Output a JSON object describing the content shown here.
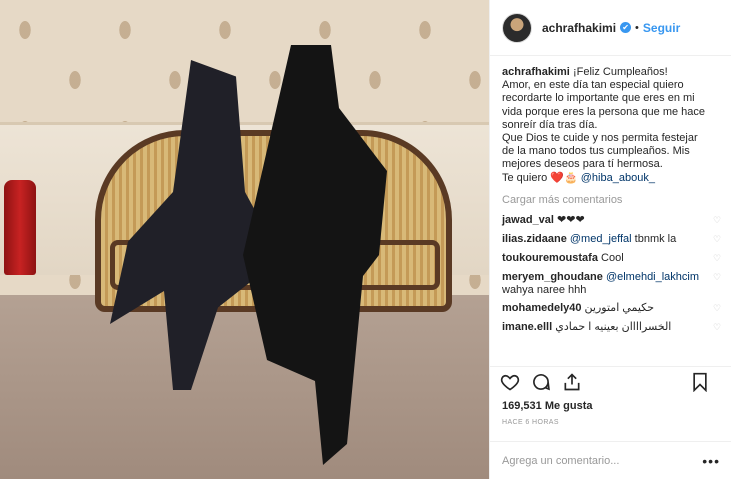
{
  "post": {
    "username": "achrafhakimi",
    "verified_mark": "✔",
    "separator": "•",
    "follow_label": "Seguir"
  },
  "caption": {
    "username": "achrafhakimi",
    "lines": [
      "¡Feliz Cumpleaños!",
      "Amor, en este día tan especial quiero",
      "recordarte lo importante que eres en mi",
      "vida porque eres la persona que me hace",
      "sonreír día tras día.",
      "Que Dios te cuide y nos permita festejar",
      "de la mano todos tus cumpleaños. Mis",
      "mejores deseos para tí hermosa."
    ],
    "last_line_text": "Te quiero ❤️🎂",
    "mention": "@hiba_abouk_"
  },
  "load_more_label": "Cargar más comentarios",
  "comments": [
    {
      "user": "jawad_val",
      "text": "❤❤❤",
      "mention": ""
    },
    {
      "user": "ilias.zidaane",
      "text": " tbnmk la",
      "mention": "@med_jeffal"
    },
    {
      "user": "toukouremoustafa",
      "text": "Cool",
      "mention": ""
    },
    {
      "user": "meryem_ghoudane",
      "text": " wahya naree hhh",
      "mention": "@elmehdi_lakhcim"
    },
    {
      "user": "mohamedely40",
      "text": "حكيمي امتورين",
      "mention": ""
    },
    {
      "user": "imane.elll",
      "text": "الخسراااان بعينيه ا حمادي",
      "mention": ""
    }
  ],
  "icons": {
    "like": "heart-icon",
    "comment": "comment-icon",
    "share": "share-icon",
    "save": "bookmark-icon",
    "small_like": "♡"
  },
  "likes_label": "169,531 Me gusta",
  "timestamp": "HACE 6 HORAS",
  "add_comment_placeholder": "Agrega un comentario...",
  "more_options": "•••",
  "colors": {
    "link_blue": "#3897f0",
    "mention_blue": "#003569",
    "muted": "#999999",
    "border": "#efefef"
  }
}
